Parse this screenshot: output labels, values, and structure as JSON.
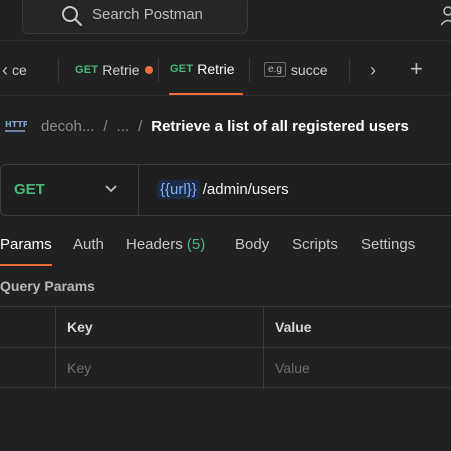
{
  "search": {
    "placeholder": "Search Postman",
    "icon": "search-icon"
  },
  "tabs": [
    {
      "partial": "ce",
      "method": "",
      "name": ""
    },
    {
      "method": "GET",
      "name": "Retrie",
      "unsaved": true
    },
    {
      "method": "GET",
      "name": "Retrie",
      "active": true
    },
    {
      "badge": "e.g",
      "name": "succe"
    }
  ],
  "tab_nav": {
    "prev": "‹",
    "next": "›",
    "add": "+"
  },
  "breadcrumb": {
    "workspace": "decoh...",
    "sep": "/",
    "ellipsis": "...",
    "title": "Retrieve a list of all registered users"
  },
  "request": {
    "method": "GET",
    "url_variable": "{{url}}",
    "url_path": "/admin/users"
  },
  "request_tabs": {
    "params": "Params",
    "auth": "Auth",
    "headers": "Headers",
    "headers_count": "(5)",
    "body": "Body",
    "scripts": "Scripts",
    "settings": "Settings"
  },
  "query_params": {
    "title": "Query Params",
    "columns": {
      "key": "Key",
      "value": "Value"
    },
    "row": {
      "key_placeholder": "Key",
      "value_placeholder": "Value"
    }
  },
  "colors": {
    "accent": "#f26b3a",
    "get_method": "#49b97a",
    "variable": "#7fb3ff"
  }
}
